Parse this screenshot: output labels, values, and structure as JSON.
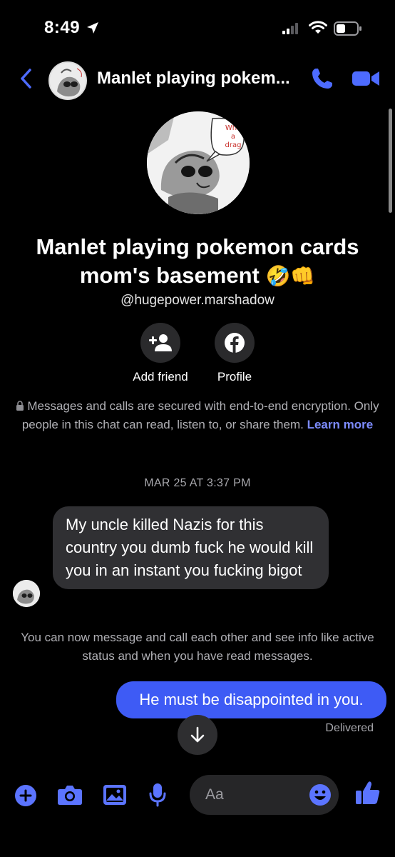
{
  "status": {
    "time": "8:49"
  },
  "header": {
    "title": "Manlet playing pokem..."
  },
  "profile": {
    "avatar_caption": [
      "Wha",
      "a",
      "drag"
    ],
    "name_line1": "Manlet playing pokemon cards",
    "name_line2": "mom's basement",
    "name_emojis": "🤣👊",
    "handle": "@hugepower.marshadow",
    "actions": [
      {
        "label": "Add friend",
        "icon": "add-friend-icon"
      },
      {
        "label": "Profile",
        "icon": "facebook-icon"
      }
    ]
  },
  "encryption": {
    "text": "Messages and calls are secured with end-to-end encryption. Only people in this chat can read, listen to, or share them.",
    "link": "Learn more"
  },
  "conversation": {
    "timestamp": "MAR 25 AT 3:37 PM",
    "incoming_message": "My uncle killed Nazis for this country you dumb fuck he would kill you in an instant you fucking bigot",
    "system_note": "You can now message and call each other and see info like active status and when you have read messages.",
    "outgoing_message": "He must be disappointed in you.",
    "delivery_status": "Delivered"
  },
  "composer": {
    "placeholder": "Aa"
  },
  "colors": {
    "accent": "#3e5bf5",
    "icon_accent": "#5b74ff",
    "link": "#7d8cff",
    "incoming_bubble": "#303033"
  }
}
